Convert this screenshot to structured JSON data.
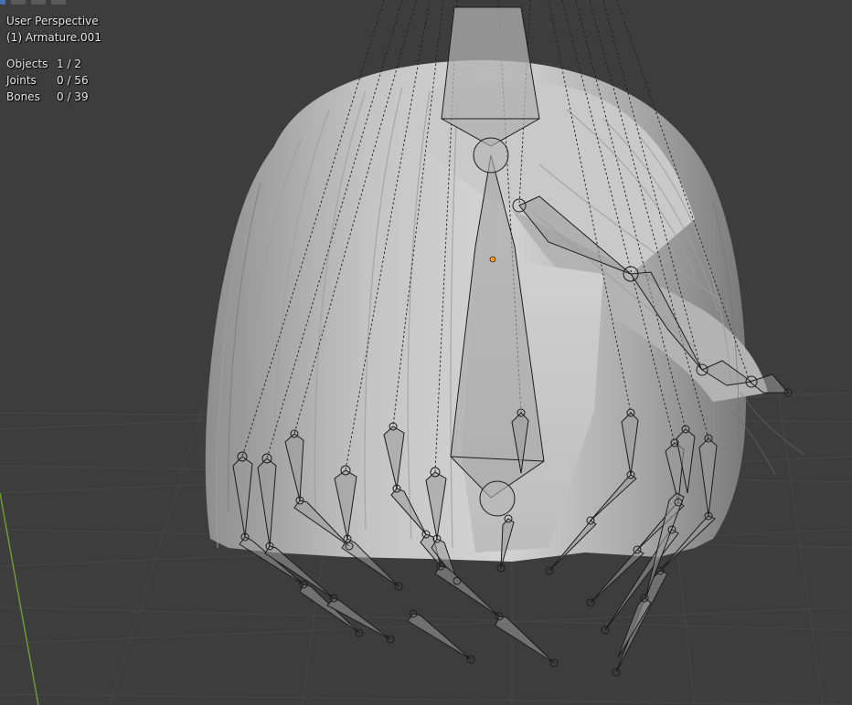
{
  "viewport": {
    "view_name": "User Perspective",
    "active_object": "(1) Armature.001",
    "stats": [
      {
        "label": "Objects",
        "value": "1 / 2"
      },
      {
        "label": "Joints",
        "value": "0 / 56"
      },
      {
        "label": "Bones",
        "value": "0 / 39"
      }
    ]
  },
  "header_icons": [
    "select-box-icon",
    "select-mode-icon",
    "select-mode-icon",
    "select-mode-icon"
  ],
  "colors": {
    "background": "#3d3d3d",
    "grid": "#474747",
    "y_axis": "#6a9a34",
    "mesh": "#b9b9b9",
    "bone_fill": "#9a9a9a",
    "bone_outline": "#1c1c1c",
    "origin": "#ff9b1a"
  }
}
